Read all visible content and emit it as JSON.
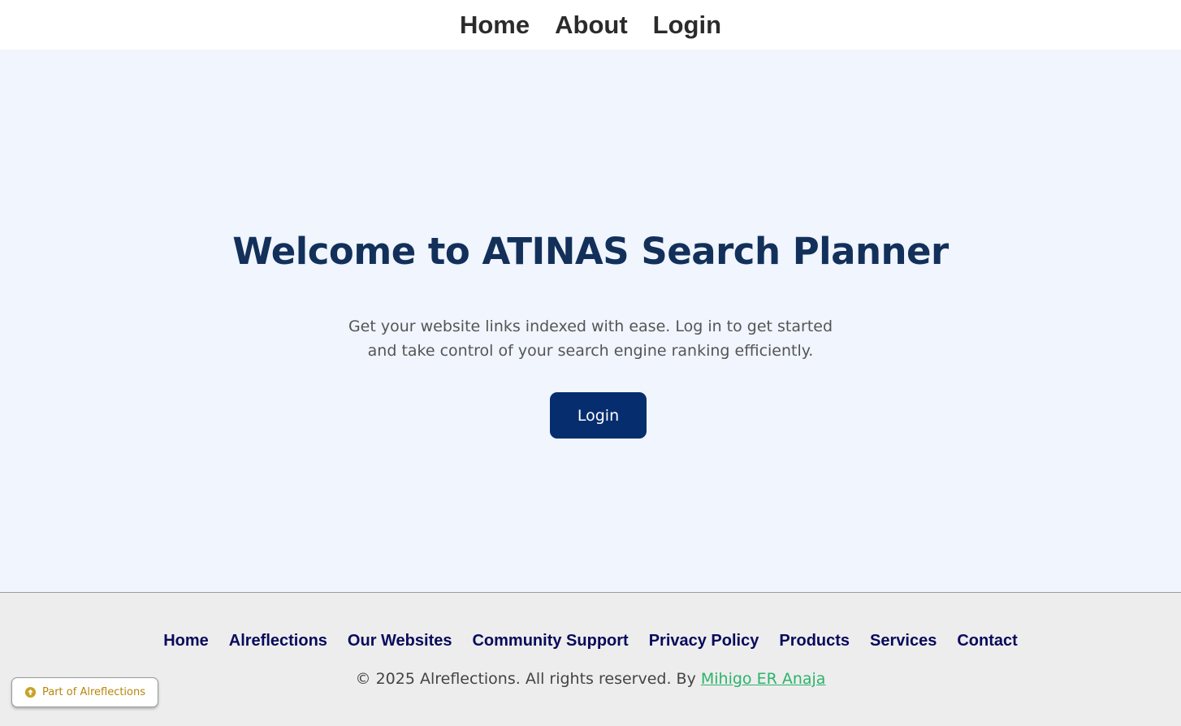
{
  "topnav": {
    "items": [
      {
        "label": "Home"
      },
      {
        "label": "About"
      },
      {
        "label": "Login"
      }
    ]
  },
  "hero": {
    "title": "Welcome to ATINAS Search Planner",
    "lead_line1": "Get your website links indexed with ease. Log in to get started",
    "lead_line2": "and take control of your search engine ranking efficiently.",
    "cta_label": "Login"
  },
  "footer": {
    "links": [
      {
        "label": "Home"
      },
      {
        "label": "Alreflections"
      },
      {
        "label": "Our Websites"
      },
      {
        "label": "Community Support"
      },
      {
        "label": "Privacy Policy"
      },
      {
        "label": "Products"
      },
      {
        "label": "Services"
      },
      {
        "label": "Contact"
      }
    ],
    "copyright_text": "© 2025 Alreflections. All rights reserved. By ",
    "author_link": "Mihigo ER Anaja"
  },
  "badge": {
    "label": "Part of Alreflections",
    "icon": "upload-circle-icon"
  },
  "colors": {
    "hero_bg": "#f0f5fe",
    "title": "#12305a",
    "cta_bg": "#062d6e",
    "footer_bg": "#ededed",
    "footer_link": "#0a0a5c",
    "author_link": "#2db36b",
    "badge_text": "#b8860b"
  }
}
